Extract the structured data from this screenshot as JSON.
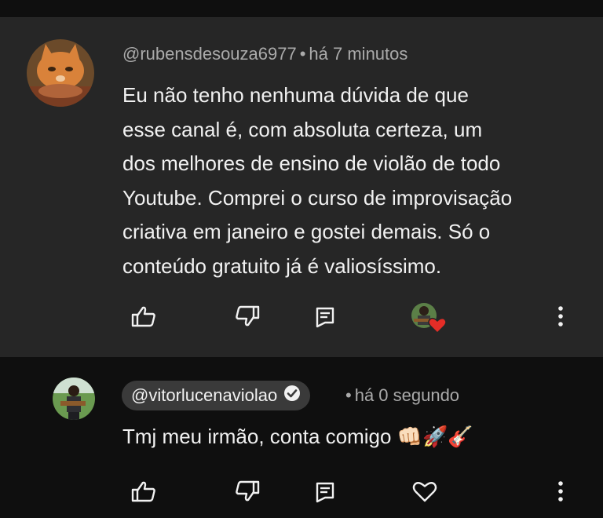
{
  "comment": {
    "author": "@rubensdesouza6977",
    "separator": "•",
    "time": "há 7 minutos",
    "text_lines": [
      "Eu não tenho nenhuma dúvida de que",
      "esse canal é, com absoluta certeza, um",
      "dos melhores de ensino de violão de todo",
      "Youtube. Comprei o curso de improvisação",
      "criativa em janeiro e gostei demais. Só o",
      "conteúdo gratuito já é valiosíssimo."
    ],
    "actions": [
      "like-icon",
      "dislike-icon",
      "reply-icon",
      "creator-heart-icon",
      "more-vert-icon"
    ]
  },
  "reply": {
    "author": "@vitorlucenaviolao",
    "separator": "•",
    "time": "há 0 segundo",
    "text": "Tmj meu irmão, conta comigo 👊🏻🚀🎸",
    "actions": [
      "like-icon",
      "dislike-icon",
      "reply-icon",
      "heart-icon",
      "more-vert-icon"
    ]
  },
  "colors": {
    "comment_bg": "#262626",
    "reply_bg": "#0f0f0f",
    "handle_pill": "#3a3a3a",
    "meta_text": "#aaaaaa",
    "heart_red": "#e52d27"
  }
}
